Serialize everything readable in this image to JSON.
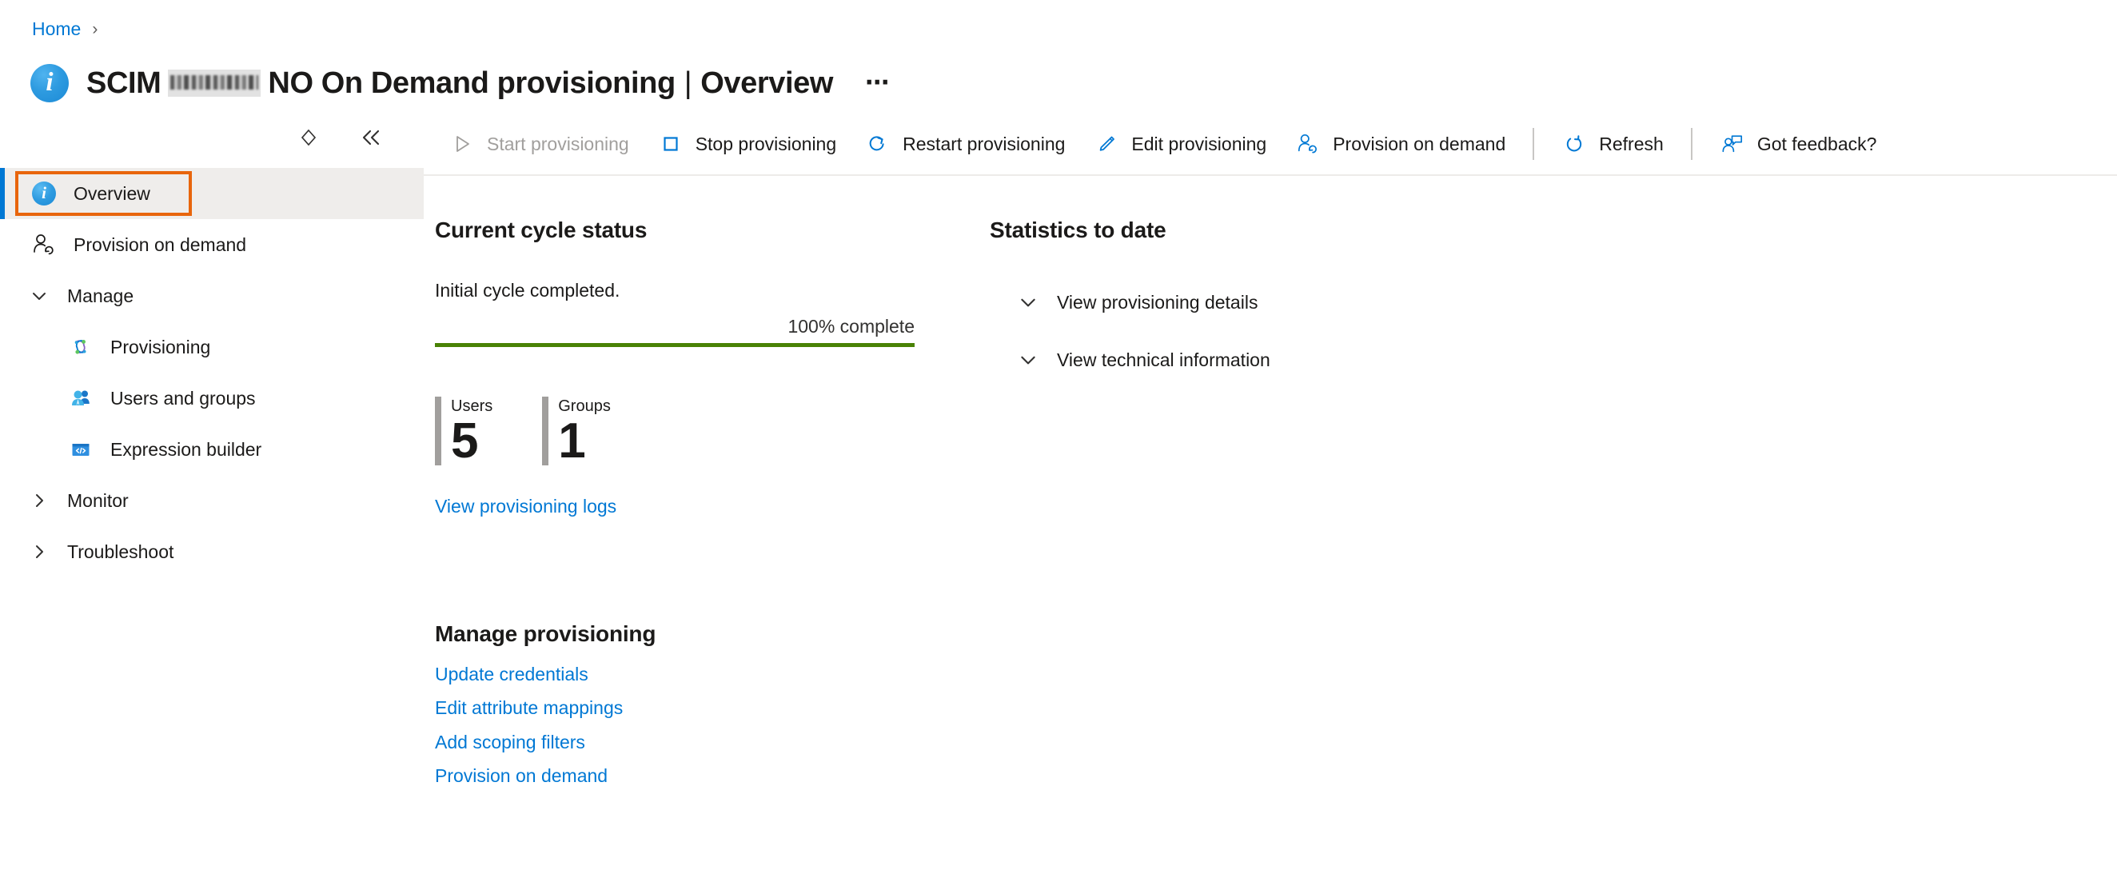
{
  "breadcrumb": {
    "items": [
      {
        "label": "Home",
        "separator": "›"
      }
    ]
  },
  "header": {
    "icon": "info-circle-icon",
    "title_prefix": "SCIM",
    "title_redacted": "██████",
    "title_middle": "NO On Demand provisioning",
    "title_separator": "|",
    "title_suffix": "Overview",
    "more_menu": "⋯"
  },
  "leftnav": {
    "tools": [
      {
        "name": "search-filter-icon",
        "tooltip": "Search"
      },
      {
        "name": "collapse-panel-icon",
        "tooltip": "Collapse"
      }
    ],
    "items": [
      {
        "label": "Overview",
        "icon": "info-circle-icon",
        "selected": true,
        "level": 0,
        "type": "link"
      },
      {
        "label": "Provision on demand",
        "icon": "user-sync-icon",
        "selected": false,
        "level": 0,
        "type": "link"
      },
      {
        "label": "Manage",
        "icon": "chevron-down-icon",
        "selected": false,
        "level": 0,
        "type": "group",
        "expanded": true
      },
      {
        "label": "Provisioning",
        "icon": "provisioning-icon",
        "selected": false,
        "level": 1,
        "type": "link"
      },
      {
        "label": "Users and groups",
        "icon": "users-groups-icon",
        "selected": false,
        "level": 1,
        "type": "link"
      },
      {
        "label": "Expression builder",
        "icon": "code-window-icon",
        "selected": false,
        "level": 1,
        "type": "link"
      },
      {
        "label": "Monitor",
        "icon": "chevron-right-icon",
        "selected": false,
        "level": 0,
        "type": "group",
        "expanded": false
      },
      {
        "label": "Troubleshoot",
        "icon": "chevron-right-icon",
        "selected": false,
        "level": 0,
        "type": "group",
        "expanded": false
      }
    ]
  },
  "commandbar": {
    "items": [
      {
        "label": "Start provisioning",
        "icon": "play-triangle-icon",
        "disabled": true
      },
      {
        "label": "Stop provisioning",
        "icon": "stop-square-icon",
        "disabled": false
      },
      {
        "label": "Restart provisioning",
        "icon": "restart-arrow-icon",
        "disabled": false
      },
      {
        "label": "Edit provisioning",
        "icon": "pencil-icon",
        "disabled": false
      },
      {
        "label": "Provision on demand",
        "icon": "user-sync-icon",
        "disabled": false
      },
      {
        "label": "Refresh",
        "icon": "refresh-circle-icon",
        "disabled": false
      },
      {
        "label": "Got feedback?",
        "icon": "feedback-person-icon",
        "disabled": false
      }
    ]
  },
  "main": {
    "cycle": {
      "section_title": "Current cycle status",
      "status_text": "Initial cycle completed.",
      "progress_label": "100% complete",
      "progress_percent": 100,
      "progress_color": "#498205"
    },
    "stats": [
      {
        "label": "Users",
        "value": "5"
      },
      {
        "label": "Groups",
        "value": "1"
      }
    ],
    "logs_link": "View provisioning logs",
    "manage": {
      "section_title": "Manage provisioning",
      "links": [
        "Update credentials",
        "Edit attribute mappings",
        "Add scoping filters",
        "Provision on demand"
      ]
    },
    "statistics": {
      "section_title": "Statistics to date",
      "expanders": [
        {
          "label": "View provisioning details",
          "icon": "chevron-down-icon"
        },
        {
          "label": "View technical information",
          "icon": "chevron-down-icon"
        }
      ]
    }
  },
  "colors": {
    "accent": "#0078d4",
    "focus_ring": "#e8650c",
    "selected_bg": "#efedeb",
    "progress_green": "#498205",
    "link": "#0078d4",
    "disabled_text": "#a19f9d"
  }
}
